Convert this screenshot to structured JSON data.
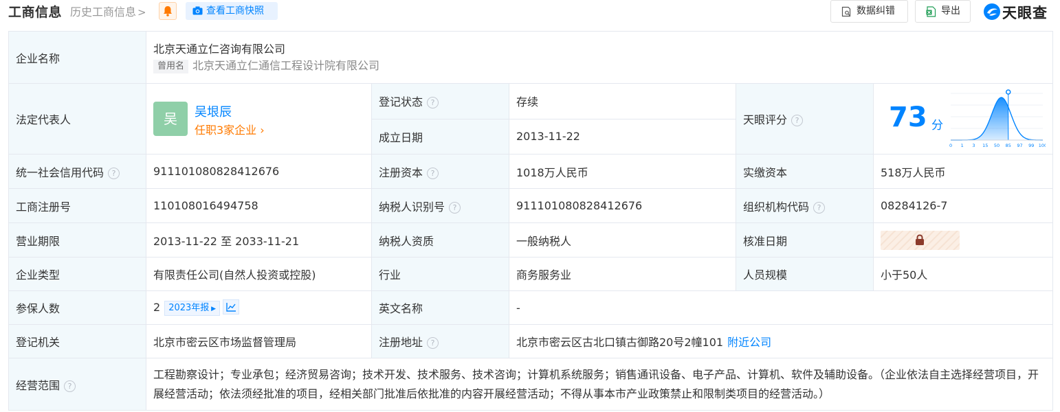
{
  "header": {
    "title": "工商信息",
    "history_link": "历史工商信息",
    "snapshot_button": "查看工商快照",
    "feedback_button": "数据纠错",
    "export_button": "导出",
    "logo_text": "天眼查"
  },
  "company": {
    "name_label": "企业名称",
    "name": "北京天通立仁咨询有限公司",
    "alias_tag": "曾用名",
    "alias": "北京天通立仁通信工程设计院有限公司"
  },
  "legal_rep": {
    "label": "法定代表人",
    "avatar_char": "吴",
    "name": "吴垠辰",
    "positions_link": "任职3家企业"
  },
  "status": {
    "label": "登记状态",
    "value": "存续"
  },
  "founded": {
    "label": "成立日期",
    "value": "2013-11-22"
  },
  "tianyan_score": {
    "label": "天眼评分",
    "value": "73",
    "unit": "分",
    "chart_ticks": [
      "0",
      "1",
      "3",
      "15",
      "50",
      "85",
      "97",
      "99",
      "100"
    ],
    "marker_tick": "85"
  },
  "rows": {
    "credit_code": {
      "label": "统一社会信用代码",
      "value": "911101080828412676"
    },
    "reg_capital": {
      "label": "注册资本",
      "value": "1018万人民币"
    },
    "paid_capital": {
      "label": "实缴资本",
      "value": "518万人民币"
    },
    "reg_number": {
      "label": "工商注册号",
      "value": "110108016494758"
    },
    "taxpayer_id": {
      "label": "纳税人识别号",
      "value": "911101080828412676"
    },
    "org_code": {
      "label": "组织机构代码",
      "value": "08284126-7"
    },
    "term": {
      "label": "营业期限",
      "value": "2013-11-22 至 2033-11-21"
    },
    "taxpayer_type": {
      "label": "纳税人资质",
      "value": "一般纳税人"
    },
    "approve_date": {
      "label": "核准日期"
    },
    "company_type": {
      "label": "企业类型",
      "value": "有限责任公司(自然人投资或控股)"
    },
    "industry": {
      "label": "行业",
      "value": "商务服务业"
    },
    "staff_size": {
      "label": "人员规模",
      "value": "小于50人"
    },
    "insured": {
      "label": "参保人数",
      "value": "2",
      "year_tag": "2023年报"
    },
    "english_name": {
      "label": "英文名称",
      "value": "-"
    },
    "authority": {
      "label": "登记机关",
      "value": "北京市密云区市场监督管理局"
    },
    "address": {
      "label": "注册地址",
      "value": "北京市密云区古北口镇古御路20号2幢101",
      "nearby_link": "附近公司"
    },
    "scope": {
      "label": "经营范围",
      "value": "工程勘察设计；专业承包；经济贸易咨询；技术开发、技术服务、技术咨询；计算机系统服务；销售通讯设备、电子产品、计算机、软件及辅助设备。（企业依法自主选择经营项目，开展经营活动；依法须经批准的项目，经相关部门批准后依批准的内容开展经营活动；不得从事本市产业政策禁止和限制类项目的经营活动。）"
    }
  },
  "colors": {
    "accent_blue": "#0084ff",
    "status_green": "#1da152",
    "link_orange": "#ff7a00",
    "label_bg": "#f2f9fc"
  }
}
